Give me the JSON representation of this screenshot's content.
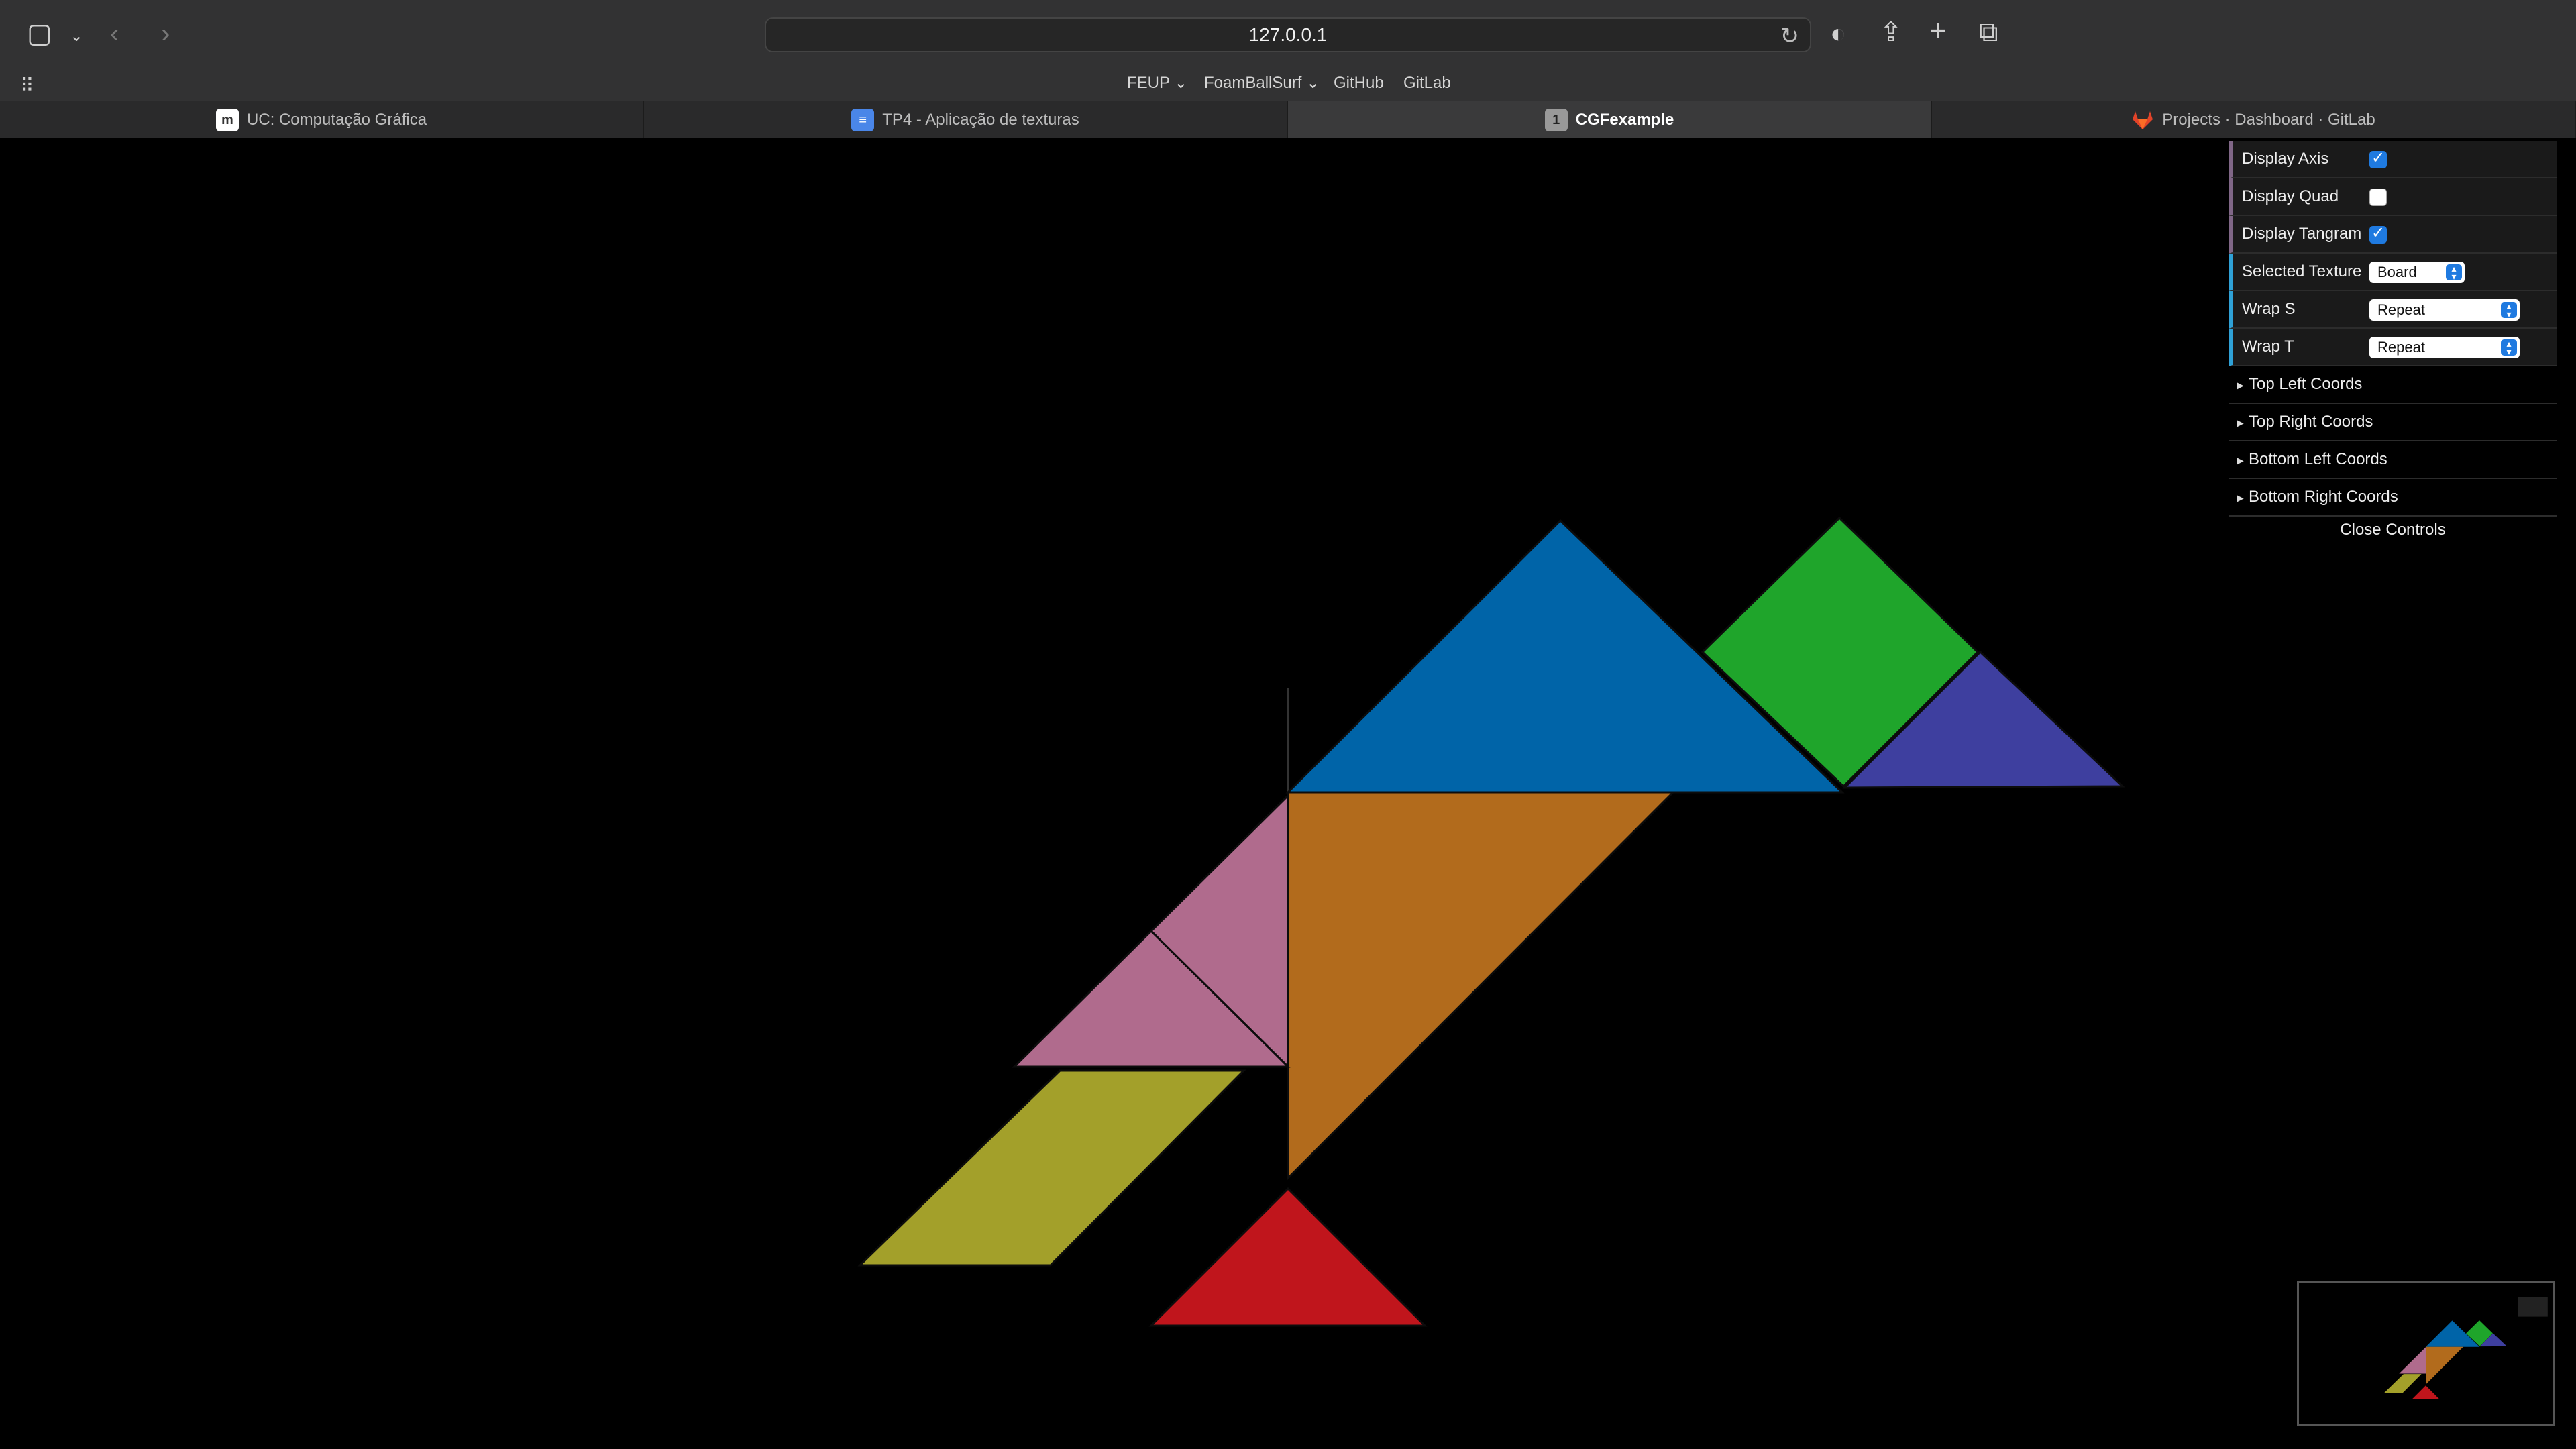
{
  "browser": {
    "url": "127.0.0.1",
    "bookmarks": [
      {
        "label": "FEUP",
        "has_menu": true
      },
      {
        "label": "FoamBallSurf",
        "has_menu": true
      },
      {
        "label": "GitHub",
        "has_menu": false
      },
      {
        "label": "GitLab",
        "has_menu": false
      }
    ],
    "tabs": [
      {
        "label": "UC: Computação Gráfica",
        "icon": "moodle-icon",
        "active": false
      },
      {
        "label": "TP4 - Aplicação de texturas",
        "icon": "docs-icon",
        "active": false
      },
      {
        "label": "CGFexample",
        "icon": "number-one-icon",
        "icon_text": "1",
        "active": true
      },
      {
        "label": "Projects · Dashboard · GitLab",
        "icon": "gitlab-icon",
        "active": false
      }
    ]
  },
  "gui": {
    "display_axis": {
      "label": "Display Axis",
      "checked": true
    },
    "display_quad": {
      "label": "Display Quad",
      "checked": false
    },
    "display_tangram": {
      "label": "Display Tangram",
      "checked": true
    },
    "selected_texture": {
      "label": "Selected Texture",
      "value": "Board"
    },
    "wrap_s": {
      "label": "Wrap S",
      "value": "Repeat"
    },
    "wrap_t": {
      "label": "Wrap T",
      "value": "Repeat"
    },
    "folders": [
      "Top Left Coords",
      "Top Right Coords",
      "Bottom Left Coords",
      "Bottom Right Coords"
    ],
    "close_label": "Close Controls"
  },
  "scene": {
    "colors": {
      "blue": "#0064a8",
      "green": "#1fa52b",
      "indigo": "#3e3f9f",
      "orange": "#b26b1c",
      "pink": "#b06b8d",
      "yellow": "#a3a02a",
      "red": "#c0151c"
    }
  }
}
